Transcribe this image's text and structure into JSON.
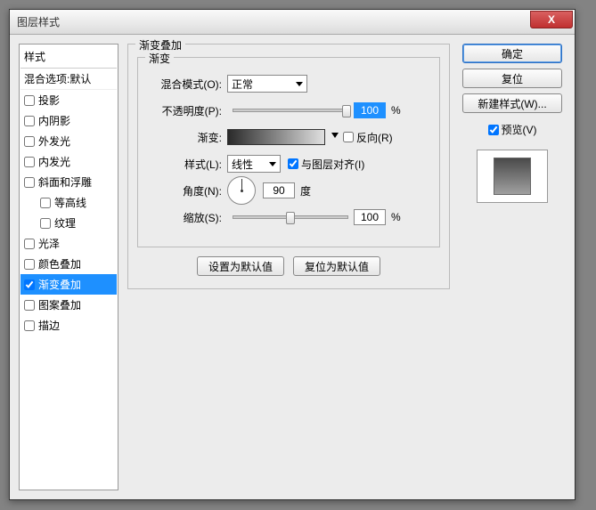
{
  "window": {
    "title": "图层样式",
    "close_icon": "X"
  },
  "sidebar": {
    "head": "样式",
    "blend_default": "混合选项:默认",
    "items": [
      {
        "label": "投影",
        "checked": false,
        "indent": false
      },
      {
        "label": "内阴影",
        "checked": false,
        "indent": false
      },
      {
        "label": "外发光",
        "checked": false,
        "indent": false
      },
      {
        "label": "内发光",
        "checked": false,
        "indent": false
      },
      {
        "label": "斜面和浮雕",
        "checked": false,
        "indent": false
      },
      {
        "label": "等高线",
        "checked": false,
        "indent": true
      },
      {
        "label": "纹理",
        "checked": false,
        "indent": true
      },
      {
        "label": "光泽",
        "checked": false,
        "indent": false
      },
      {
        "label": "颜色叠加",
        "checked": false,
        "indent": false
      },
      {
        "label": "渐变叠加",
        "checked": true,
        "indent": false,
        "selected": true
      },
      {
        "label": "图案叠加",
        "checked": false,
        "indent": false
      },
      {
        "label": "描边",
        "checked": false,
        "indent": false
      }
    ]
  },
  "panel": {
    "outer_title": "渐变叠加",
    "inner_title": "渐变",
    "blend_mode": {
      "label": "混合模式(O):",
      "value": "正常"
    },
    "opacity": {
      "label": "不透明度(P):",
      "value": "100",
      "unit": "%"
    },
    "gradient": {
      "label": "渐变:",
      "reverse_cb": "反向(R)"
    },
    "style": {
      "label": "样式(L):",
      "value": "线性",
      "align_cb": "与图层对齐(I)"
    },
    "angle": {
      "label": "角度(N):",
      "value": "90",
      "unit": "度"
    },
    "scale": {
      "label": "缩放(S):",
      "value": "100",
      "unit": "%"
    },
    "btn_default": "设置为默认值",
    "btn_reset": "复位为默认值"
  },
  "right": {
    "ok": "确定",
    "cancel": "复位",
    "new_style": "新建样式(W)...",
    "preview_cb": "预览(V)"
  }
}
